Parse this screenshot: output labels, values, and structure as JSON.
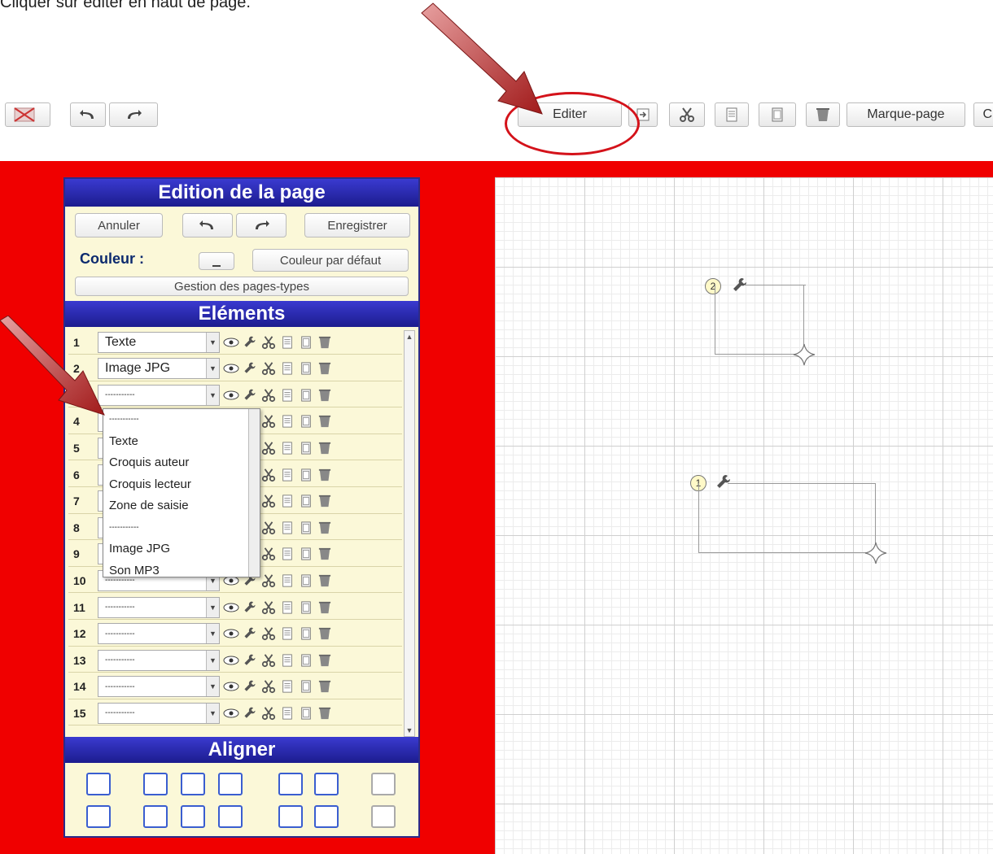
{
  "instruction": "Cliquer sur éditer en haut de page.",
  "toolbar": {
    "editer_label": "Editer",
    "marque_page_label": "Marque-page",
    "partial_label": "C"
  },
  "panel": {
    "title": "Edition de la page",
    "annuler": "Annuler",
    "enregistrer": "Enregistrer",
    "couleur_label": "Couleur :",
    "couleur_defaut": "Couleur par défaut",
    "gestion_pages": "Gestion des pages-types",
    "elements_title": "Eléments",
    "aligner_title": "Aligner"
  },
  "rows": [
    {
      "num": "1",
      "value": "Texte"
    },
    {
      "num": "2",
      "value": "Image JPG"
    },
    {
      "num": "3",
      "value": "-----------"
    },
    {
      "num": "4",
      "value": "-----------"
    },
    {
      "num": "5",
      "value": "-----------"
    },
    {
      "num": "6",
      "value": "-----------"
    },
    {
      "num": "7",
      "value": "-----------"
    },
    {
      "num": "8",
      "value": "-----------"
    },
    {
      "num": "9",
      "value": "-----------"
    },
    {
      "num": "10",
      "value": "-----------"
    },
    {
      "num": "11",
      "value": "-----------"
    },
    {
      "num": "12",
      "value": "-----------"
    },
    {
      "num": "13",
      "value": "-----------"
    },
    {
      "num": "14",
      "value": "-----------"
    },
    {
      "num": "15",
      "value": "-----------"
    }
  ],
  "dropdown_options": [
    "-----------",
    "Texte",
    "Croquis auteur",
    "Croquis lecteur",
    "Zone de saisie",
    "-----------",
    "Image JPG",
    "Son MP3"
  ],
  "canvas": {
    "badge_1": "1",
    "badge_2": "2"
  },
  "colors": {
    "accent_red": "#f00000",
    "panel_header": "#1c1c8e",
    "panel_bg": "#fbf8d8",
    "highlight_ellipse": "#d4121a"
  }
}
